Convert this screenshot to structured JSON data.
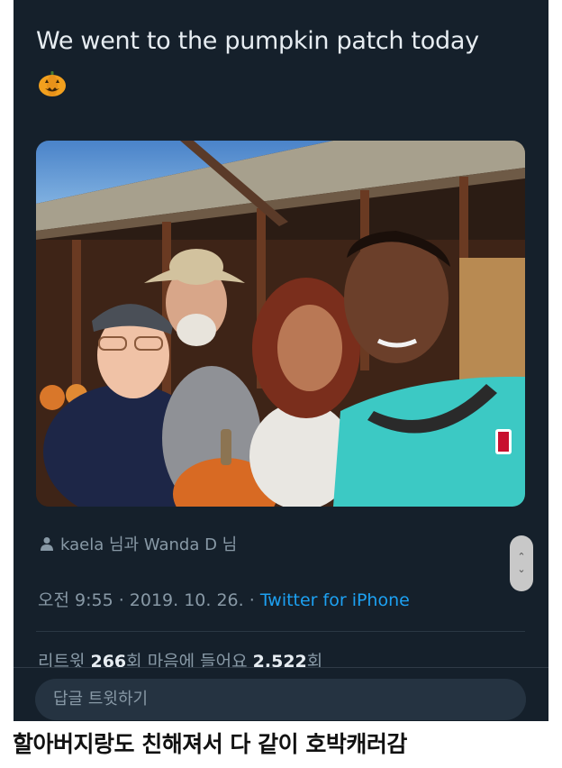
{
  "tweet": {
    "text": "We went to the pumpkin patch today",
    "emoji": "pumpkin-emoji",
    "photo_alt": "pumpkin patch selfie"
  },
  "tagged": {
    "icon": "user-icon",
    "text": "kaela 님과 Wanda D 님"
  },
  "meta": {
    "time_date": "오전 9:55 · 2019. 10. 26. · ",
    "app": "Twitter for iPhone"
  },
  "stats": {
    "retweet_label": "리트윗 ",
    "retweet_count": "266",
    "retweet_unit": "회  ",
    "like_label": "마음에 들어요 ",
    "like_count": "2,522",
    "like_unit": "회"
  },
  "reply": {
    "placeholder": "답글 트윗하기"
  },
  "scroll_handle": {
    "up": "⌃",
    "down": "⌄"
  },
  "caption": {
    "text": "할아버지랑도 친해져서 다 같이 호박캐러감"
  },
  "colors": {
    "background": "#15202b",
    "text": "#e7edf2",
    "muted": "#8899a6",
    "link": "#1da1f2"
  }
}
